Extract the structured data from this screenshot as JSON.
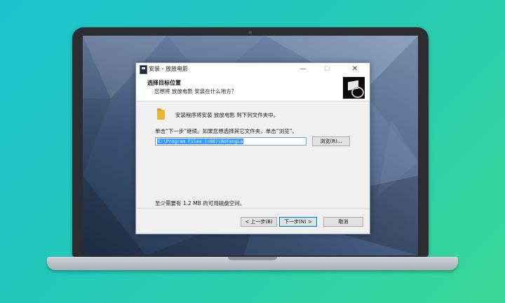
{
  "window": {
    "title": "安装 - 放放电影",
    "minimize_glyph": "—",
    "maximize_glyph": "☐",
    "close_glyph": "✕"
  },
  "header": {
    "title": "选择目标位置",
    "subtitle": "您想将 放放电影 安装在什么地方？",
    "logo_icon": "installer-logo-icon"
  },
  "content": {
    "intro": "安装程序将安装 放放电影 到下列文件夹中。",
    "instruction": "单击“下一步”继续。如果您想选择其它文件夹，单击“浏览”。",
    "path_value": "E:\\Program Files (x86)\\BoFangLa",
    "browse_label": "浏览(R)...",
    "space_required": "至少需要有 1.2 MB 的可用磁盘空间。"
  },
  "footer": {
    "back_label": "< 上一步(B)",
    "next_label": "下一步(N) >",
    "cancel_label": "取消"
  },
  "colors": {
    "background_start": "#1bc3cf",
    "background_end": "#3ad896",
    "selection": "#3399ff",
    "default_button_border": "#0078d7"
  }
}
